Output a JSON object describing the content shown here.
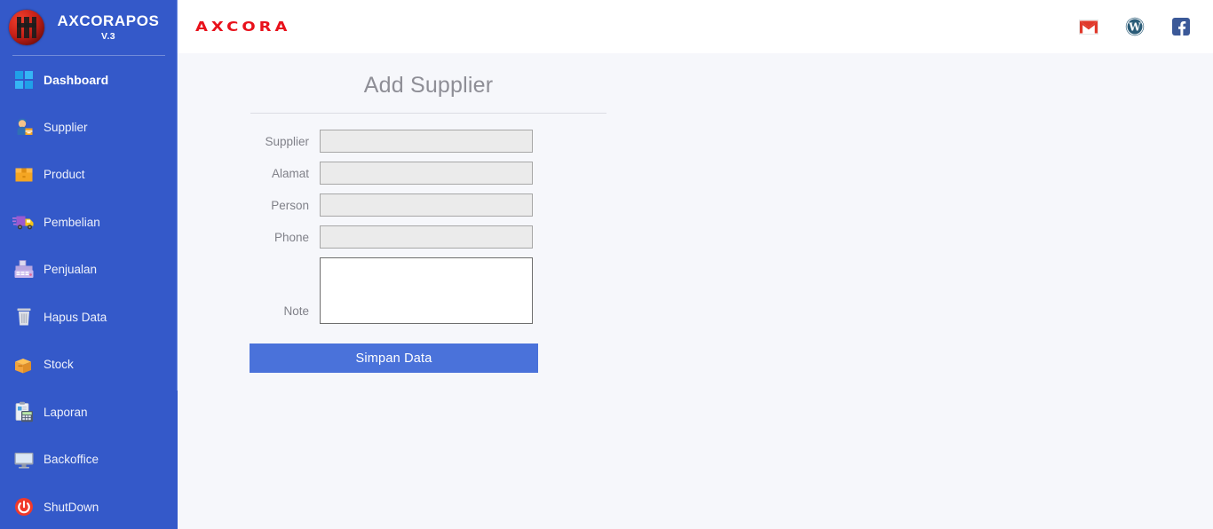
{
  "sidebar": {
    "brand": {
      "name": "AXCORAPOS",
      "version": "V.3",
      "logo_icon": "axcora-circle-logo"
    },
    "items": [
      {
        "label": "Dashboard",
        "icon": "windows-icon",
        "active": true
      },
      {
        "label": "Supplier",
        "icon": "supplier-icon",
        "active": false
      },
      {
        "label": "Product",
        "icon": "box-icon",
        "active": false
      },
      {
        "label": "Pembelian",
        "icon": "delivery-truck-icon",
        "active": false
      },
      {
        "label": "Penjualan",
        "icon": "cash-register-icon",
        "active": false
      },
      {
        "label": "Hapus Data",
        "icon": "trash-icon",
        "active": false
      },
      {
        "label": "Stock",
        "icon": "package-icon",
        "active": false
      },
      {
        "label": "Laporan",
        "icon": "clipboard-icon",
        "active": false
      },
      {
        "label": "Backoffice",
        "icon": "monitor-icon",
        "active": false
      },
      {
        "label": "ShutDown",
        "icon": "power-icon",
        "active": false
      }
    ]
  },
  "header": {
    "logo_text": "AXCORA",
    "icons": [
      {
        "name": "gmail-icon",
        "label": "Gmail"
      },
      {
        "name": "wordpress-icon",
        "label": "WordPress"
      },
      {
        "name": "facebook-icon",
        "label": "Facebook"
      }
    ]
  },
  "main": {
    "title": "Add Supplier",
    "fields": [
      {
        "label": "Supplier",
        "value": "",
        "placeholder": "",
        "type": "text"
      },
      {
        "label": "Alamat",
        "value": "",
        "placeholder": "",
        "type": "text"
      },
      {
        "label": "Person",
        "value": "",
        "placeholder": "",
        "type": "text"
      },
      {
        "label": "Phone",
        "value": "",
        "placeholder": "",
        "type": "text"
      },
      {
        "label": "Note",
        "value": "",
        "placeholder": "",
        "type": "textarea"
      }
    ],
    "submit_label": "Simpan Data"
  },
  "colors": {
    "sidebar_bg": "#3459c9",
    "header_bg": "#ffffff",
    "main_bg": "#f6f7fb",
    "button_bg": "#4a72da",
    "input_bg": "#ebebeb",
    "logo_red": "#e8111b",
    "title_gray": "#8e8e96"
  }
}
